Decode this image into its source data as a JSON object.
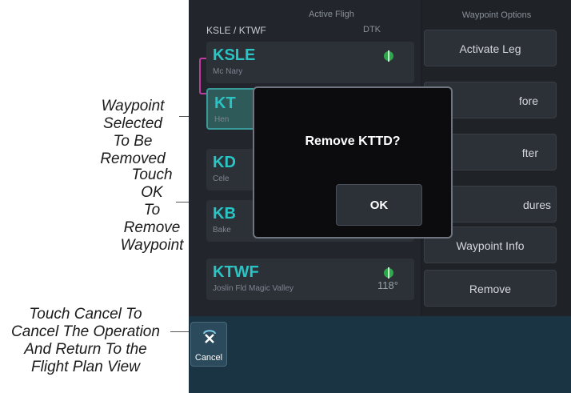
{
  "callouts": {
    "selected": [
      "Waypoint Selected",
      "To Be Removed"
    ],
    "ok": [
      "Touch OK",
      "To Remove",
      "Waypoint"
    ],
    "cancel": [
      "Touch Cancel To",
      "Cancel The Operation",
      "And Return To the",
      "Flight Plan View"
    ]
  },
  "flight_plan": {
    "nav_label": "Active Fligh",
    "route": "KSLE / KTWF",
    "dtk_header": "DTK",
    "waypoints": [
      {
        "id": "KSLE",
        "name": "Mc Nary",
        "dtk": ""
      },
      {
        "id": "KT",
        "name": "Hen",
        "dtk": ""
      },
      {
        "id": "KD",
        "name": "Cele",
        "dtk": ""
      },
      {
        "id": "KB",
        "name": "Bake",
        "dtk": ""
      },
      {
        "id": "KTWF",
        "name": "Joslin Fld Magic Valley",
        "dtk": "118°"
      }
    ]
  },
  "waypoint_options": {
    "title": "Waypoint Options",
    "buttons": [
      "Activate Leg",
      "fore",
      "fter",
      "dures",
      "Waypoint Info",
      "Remove"
    ]
  },
  "dialog": {
    "message": "Remove KTTD?",
    "ok_label": "OK"
  },
  "bottom_bar": {
    "cancel_label": "Cancel"
  },
  "colors": {
    "accent_cyan": "#29c4c4",
    "selected_fill": "#2f5a5a",
    "bottom_bar": "#1a3444",
    "dialog_bg": "#0c0c0e"
  }
}
